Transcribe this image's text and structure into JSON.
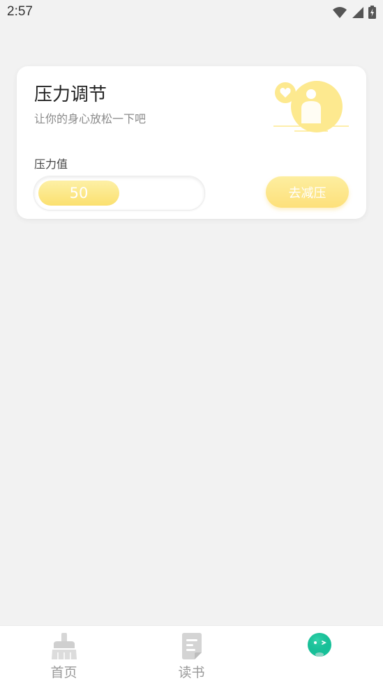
{
  "status_bar": {
    "time": "2:57",
    "icons": [
      "wifi-icon",
      "signal-icon",
      "battery-charging-icon"
    ]
  },
  "card": {
    "title": "压力调节",
    "subtitle": "让你的身心放松一下吧",
    "illustration": "relaxing-person-heart-illustration",
    "stress_label": "压力值",
    "stress_value": "50",
    "stress_fraction": 0.5,
    "action_button": "去减压"
  },
  "bottom_nav": {
    "items": [
      {
        "label": "首页",
        "icon": "broom-icon"
      },
      {
        "label": "读书",
        "icon": "document-icon"
      },
      {
        "label": "",
        "icon": "mascot-face-icon"
      }
    ]
  },
  "colors": {
    "accent_yellow": "#fbe06f",
    "background": "#f2f2f2",
    "mascot_green": "#16c29a"
  }
}
